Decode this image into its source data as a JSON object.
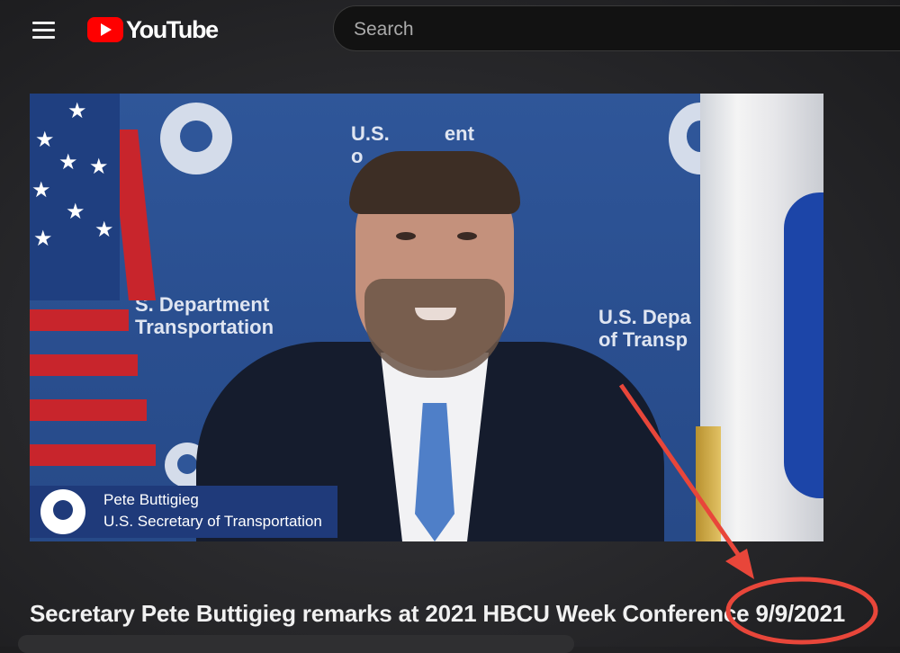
{
  "header": {
    "logo_text": "YouTube",
    "search_placeholder": "Search"
  },
  "video": {
    "backdrop_text_left": "S. Department\nTransportation",
    "backdrop_text_top": "U.S.          ent\no              n",
    "backdrop_text_right": "U.S. Depa\nof Transp",
    "lower_third": {
      "name": "Pete Buttigieg",
      "role": "U.S. Secretary of Transportation"
    }
  },
  "title": "Secretary Pete Buttigieg remarks at 2021 HBCU Week Conference 9/9/2021",
  "colors": {
    "accent": "#ff0000",
    "annotation": "#e8463a"
  }
}
